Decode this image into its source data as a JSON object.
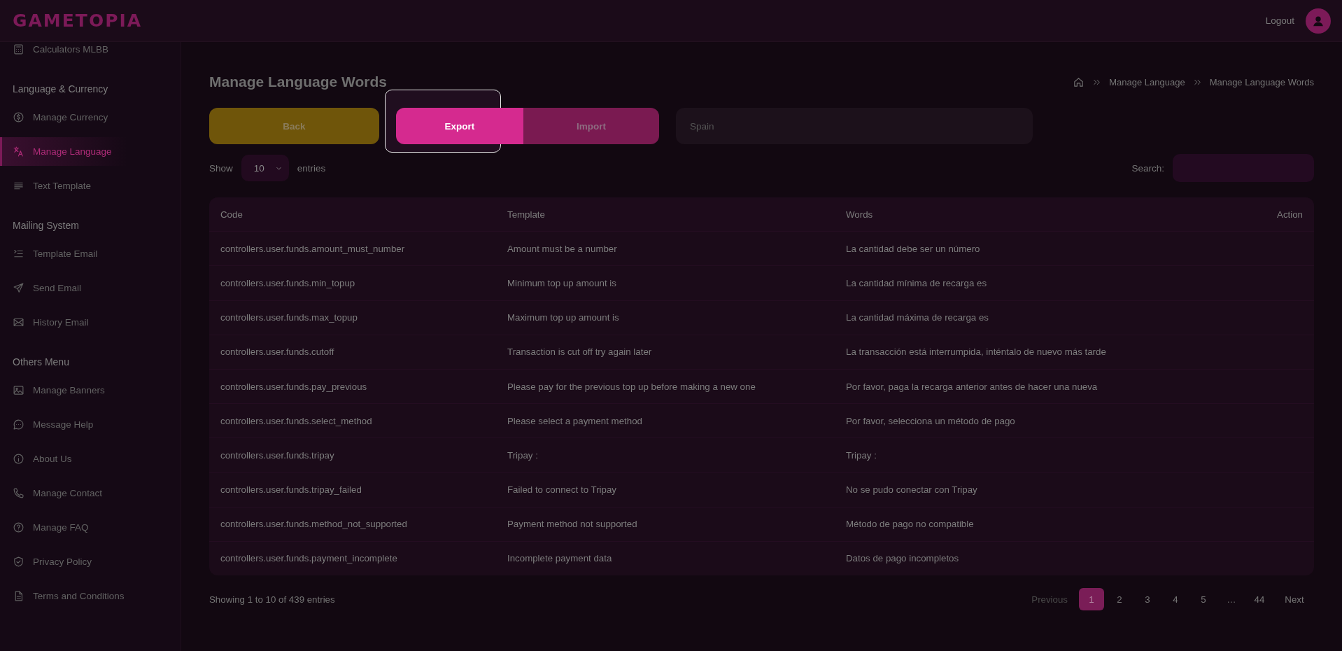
{
  "header": {
    "logo": "GAMETOPIA",
    "logout": "Logout"
  },
  "sidebar": {
    "sections": [
      {
        "items": [
          {
            "label": "Calculators MLBB",
            "selected": false
          }
        ]
      },
      {
        "title": "Language & Currency",
        "items": [
          {
            "label": "Manage Currency",
            "selected": false
          },
          {
            "label": "Manage Language",
            "selected": true
          },
          {
            "label": "Text Template",
            "selected": false
          }
        ]
      },
      {
        "title": "Mailing System",
        "items": [
          {
            "label": "Template Email",
            "selected": false
          },
          {
            "label": "Send Email",
            "selected": false
          },
          {
            "label": "History Email",
            "selected": false
          }
        ]
      },
      {
        "title": "Others Menu",
        "items": [
          {
            "label": "Manage Banners",
            "selected": false
          },
          {
            "label": "Message Help",
            "selected": false
          },
          {
            "label": "About Us",
            "selected": false
          },
          {
            "label": "Manage Contact",
            "selected": false
          },
          {
            "label": "Manage FAQ",
            "selected": false
          },
          {
            "label": "Privacy Policy",
            "selected": false
          },
          {
            "label": "Terms and Conditions",
            "selected": false
          }
        ]
      }
    ]
  },
  "page": {
    "title": "Manage Language Words",
    "breadcrumb": [
      "Manage Language",
      "Manage Language Words"
    ]
  },
  "actions": [
    {
      "kind": "back",
      "label": "Back",
      "spotlight": false
    },
    {
      "kind": "export",
      "label": "Export",
      "spotlight": true
    },
    {
      "kind": "import",
      "label": "Import",
      "spotlight": false
    }
  ],
  "language_field": {
    "value": "Spain"
  },
  "length_menu": {
    "before": "Show",
    "value": "10",
    "after": "entries"
  },
  "search": {
    "label": "Search:"
  },
  "table": {
    "columns": [
      "Code",
      "Template",
      "Words",
      "Action"
    ],
    "rows": [
      [
        "controllers.user.funds.amount_must_number",
        "Amount must be a number",
        "La cantidad debe ser un número"
      ],
      [
        "controllers.user.funds.min_topup",
        "Minimum top up amount is",
        "La cantidad mínima de recarga es"
      ],
      [
        "controllers.user.funds.max_topup",
        "Maximum top up amount is",
        "La cantidad máxima de recarga es"
      ],
      [
        "controllers.user.funds.cutoff",
        "Transaction is cut off try again later",
        "La transacción está interrumpida, inténtalo de nuevo más tarde"
      ],
      [
        "controllers.user.funds.pay_previous",
        "Please pay for the previous top up before making a new one",
        "Por favor, paga la recarga anterior antes de hacer una nueva"
      ],
      [
        "controllers.user.funds.select_method",
        "Please select a payment method",
        "Por favor, selecciona un método de pago"
      ],
      [
        "controllers.user.funds.tripay",
        "Tripay :",
        "Tripay :"
      ],
      [
        "controllers.user.funds.tripay_failed",
        "Failed to connect to Tripay",
        "No se pudo conectar con Tripay"
      ],
      [
        "controllers.user.funds.method_not_supported",
        "Payment method not supported",
        "Método de pago no compatible"
      ],
      [
        "controllers.user.funds.payment_incomplete",
        "Incomplete payment data",
        "Datos de pago incompletos"
      ]
    ]
  },
  "info": "Showing 1 to 10 of 439 entries",
  "pagination": [
    {
      "kind": "prev",
      "label": "Previous",
      "disabled": true
    },
    {
      "kind": "page",
      "label": "1",
      "selected": true
    },
    {
      "kind": "page",
      "label": "2",
      "selected": false
    },
    {
      "kind": "page",
      "label": "3",
      "selected": false
    },
    {
      "kind": "page",
      "label": "4",
      "selected": false
    },
    {
      "kind": "page",
      "label": "5",
      "selected": false
    },
    {
      "kind": "ellipsis",
      "label": "…"
    },
    {
      "kind": "page",
      "label": "44",
      "selected": false
    },
    {
      "kind": "next",
      "label": "Next",
      "disabled": false
    }
  ]
}
